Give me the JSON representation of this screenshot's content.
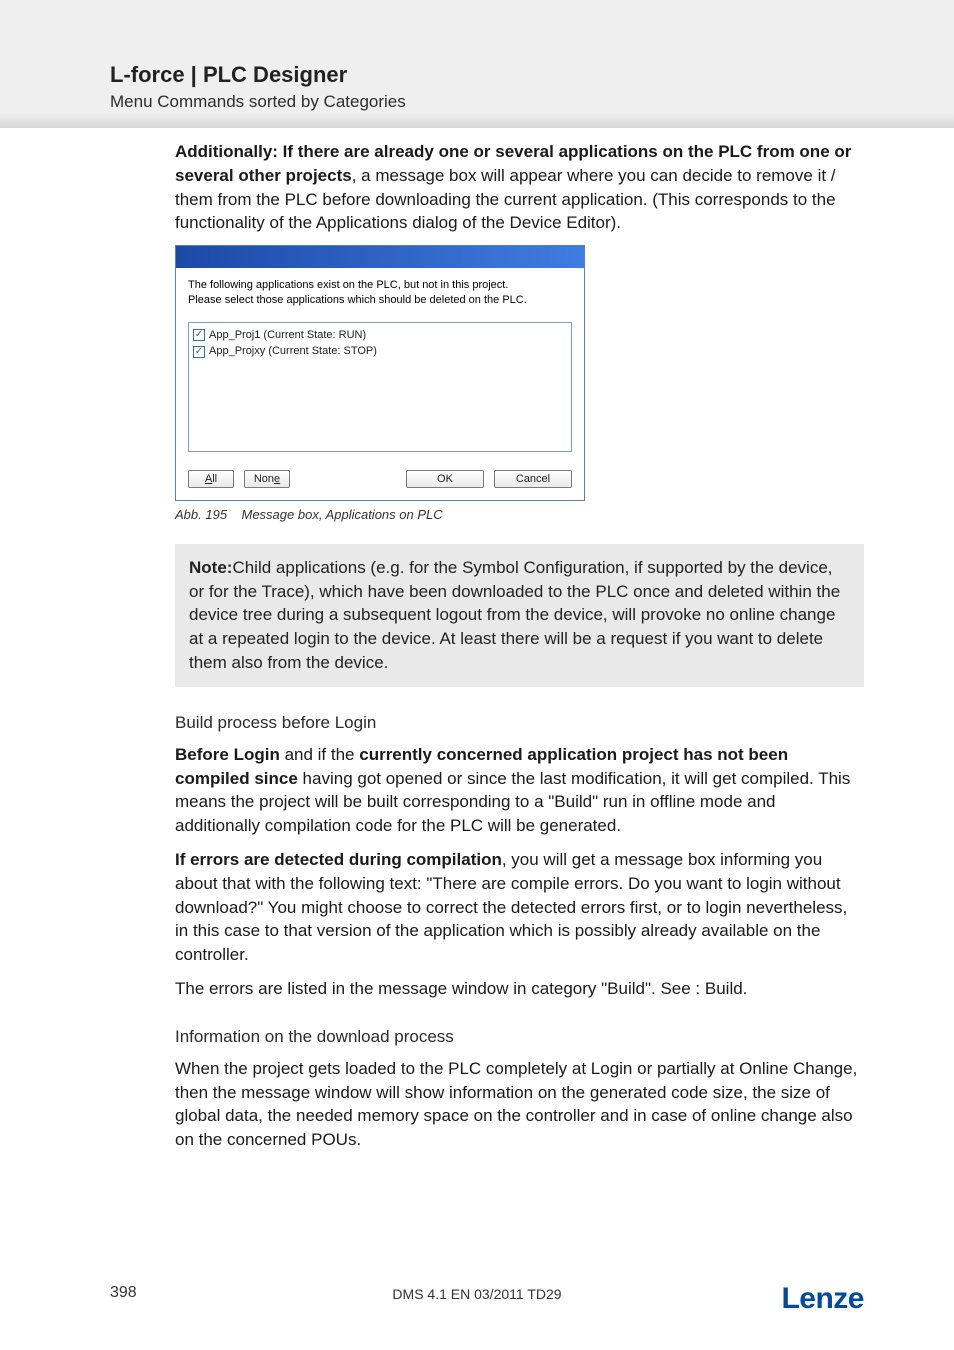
{
  "header": {
    "title": "L-force | PLC Designer",
    "subtitle": "Menu Commands sorted by Categories"
  },
  "intro": {
    "bold_lead": "Additionally: If there are already one or several applications on the PLC from one or several other projects",
    "rest": ", a message box will appear where you can decide to remove it / them from the PLC before downloading the current application. (This corresponds to the functionality of the Applications dialog of the Device Editor)."
  },
  "dialog": {
    "msg_line1": "The following applications exist on the PLC, but not in this project.",
    "msg_line2": "Please select those applications which should be deleted on the PLC.",
    "items": [
      "App_Proj1 (Current State: RUN)",
      "App_Projxy (Current State: STOP)"
    ],
    "buttons": {
      "all_pre": "A",
      "all_u": "l",
      "all_post": "l",
      "none_pre": "Non",
      "none_u": "e",
      "ok": "OK",
      "cancel": "Cancel"
    }
  },
  "caption": {
    "label": "Abb. 195",
    "text": "Message box, Applications on PLC"
  },
  "note": {
    "label": "Note:",
    "text": "Child applications (e.g. for the Symbol Configuration, if supported by the device, or for the Trace), which have been downloaded to the PLC once and deleted within the device tree during a subsequent logout from the device, will provoke no online change at a repeated login to the device. At least there will be a request if you want to delete them also from the device."
  },
  "build": {
    "heading": "Build process before Login",
    "p1_bold1": "Before Login",
    "p1_mid": " and if the ",
    "p1_bold2": "currently concerned application project has not been compiled since",
    "p1_rest": " having got opened or since the last modification, it will get compiled. This means the project will be built corresponding to a \"Build\" run in offline mode and additionally compilation code for the PLC will be generated.",
    "p2_bold": "If errors are detected during compilation",
    "p2_rest": ", you will get a message box informing you about that with the following text: \"There are compile errors. Do you want to login without download?\" You might choose to correct the detected errors first, or to login nevertheless, in this case to that version of the application which is possibly already available on the controller.",
    "p3": "The errors are listed in the message window in category \"Build\". See : Build."
  },
  "download": {
    "heading": "Information on the download process",
    "p1": "When the project gets loaded to the PLC completely at Login or partially at Online Change, then the message window will show information on the generated code size, the size of global data, the needed memory space on the controller and in case of online change also on the concerned POUs."
  },
  "footer": {
    "page_number": "398",
    "doc_id": "DMS 4.1 EN 03/2011 TD29",
    "brand": "Lenze"
  }
}
